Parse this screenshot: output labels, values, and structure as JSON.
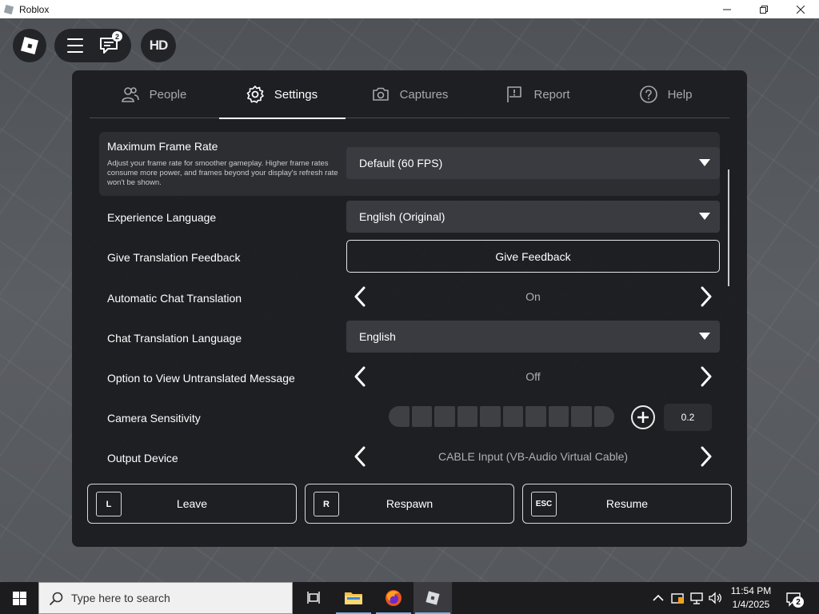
{
  "window": {
    "title": "Roblox"
  },
  "hud": {
    "chat_badge": "2",
    "hd_label": "HD"
  },
  "tabs": [
    {
      "label": "People",
      "icon": "people-icon"
    },
    {
      "label": "Settings",
      "icon": "gear-icon",
      "active": true
    },
    {
      "label": "Captures",
      "icon": "camera-icon"
    },
    {
      "label": "Report",
      "icon": "flag-icon"
    },
    {
      "label": "Help",
      "icon": "help-icon"
    }
  ],
  "settings": {
    "frame_rate": {
      "label": "Maximum Frame Rate",
      "description": "Adjust your frame rate for smoother gameplay. Higher frame rates consume more power, and frames beyond your display's refresh rate won't be shown.",
      "value": "Default (60 FPS)"
    },
    "experience_language": {
      "label": "Experience Language",
      "value": "English (Original)"
    },
    "translation_feedback": {
      "label": "Give Translation Feedback",
      "button": "Give Feedback"
    },
    "auto_chat_translation": {
      "label": "Automatic Chat Translation",
      "value": "On"
    },
    "chat_translation_language": {
      "label": "Chat Translation Language",
      "value": "English"
    },
    "untranslated_option": {
      "label": "Option to View Untranslated Message",
      "value": "Off"
    },
    "camera_sensitivity": {
      "label": "Camera Sensitivity",
      "value": "0.2",
      "segments": 10
    },
    "output_device": {
      "label": "Output Device",
      "value": "CABLE Input (VB-Audio Virtual Cable)"
    }
  },
  "footer": {
    "leave": {
      "key": "L",
      "label": "Leave"
    },
    "respawn": {
      "key": "R",
      "label": "Respawn"
    },
    "resume": {
      "key": "ESC",
      "label": "Resume"
    }
  },
  "taskbar": {
    "search_placeholder": "Type here to search",
    "time": "11:54 PM",
    "date": "1/4/2025",
    "notification_count": "2"
  }
}
